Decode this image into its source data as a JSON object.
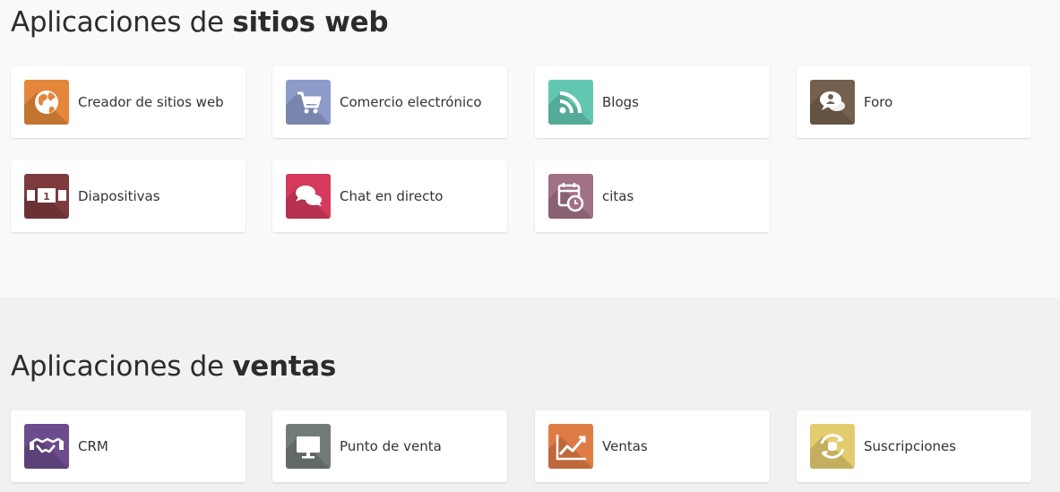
{
  "website_section": {
    "title_prefix": "Aplicaciones de ",
    "title_strong": "sitios web",
    "apps": [
      {
        "label": "Creador de sitios web",
        "icon": "globe-icon",
        "color": "#e4873a"
      },
      {
        "label": "Comercio electrónico",
        "icon": "shopping-cart-icon",
        "color": "#8d9bc9"
      },
      {
        "label": "Blogs",
        "icon": "rss-icon",
        "color": "#62c7b0"
      },
      {
        "label": "Foro",
        "icon": "chat-user-icon",
        "color": "#75604e"
      },
      {
        "label": "Diapositivas",
        "icon": "slides-icon",
        "color": "#7d3b3e"
      },
      {
        "label": "Chat en directo",
        "icon": "chat-bubbles-icon",
        "color": "#d5395c"
      },
      {
        "label": "citas",
        "icon": "calendar-clock-icon",
        "color": "#a17185"
      }
    ]
  },
  "sales_section": {
    "title_prefix": "Aplicaciones de ",
    "title_strong": "ventas",
    "apps": [
      {
        "label": "CRM",
        "icon": "handshake-icon",
        "color": "#6c4c8c"
      },
      {
        "label": "Punto de venta",
        "icon": "monitor-icon",
        "color": "#727c77"
      },
      {
        "label": "Ventas",
        "icon": "chart-up-icon",
        "color": "#df7b45"
      },
      {
        "label": "Suscripciones",
        "icon": "recurring-coins-icon",
        "color": "#e3cc6e"
      }
    ]
  }
}
